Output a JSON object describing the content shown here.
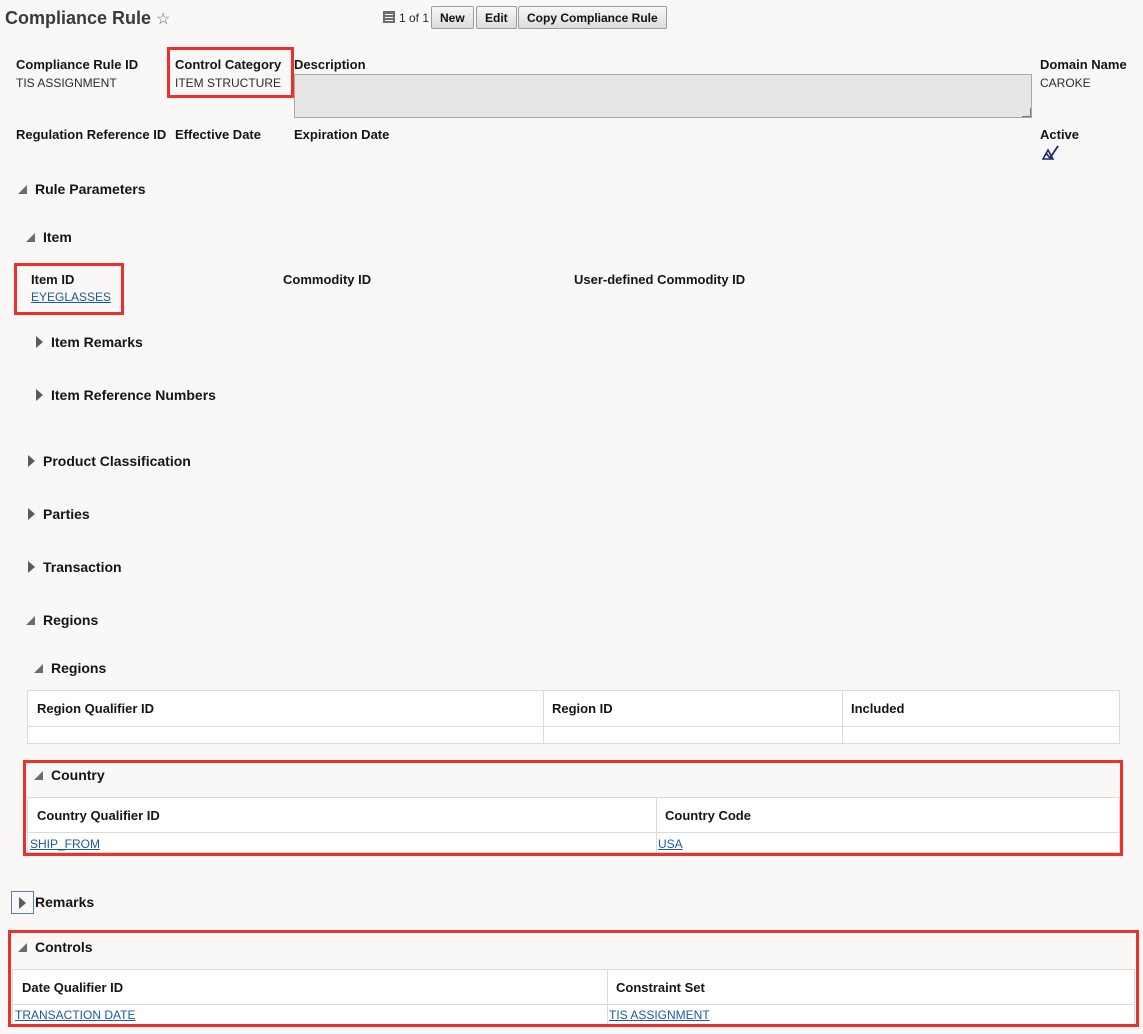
{
  "header": {
    "title": "Compliance Rule",
    "favorite_icon": "star-icon",
    "record_counter": "1 of 1",
    "new_label": "New",
    "edit_label": "Edit",
    "copy_label": "Copy Compliance Rule"
  },
  "fields": {
    "rule_id_label": "Compliance Rule ID",
    "rule_id_value": "TIS ASSIGNMENT",
    "control_category_label": "Control Category",
    "control_category_value": "ITEM STRUCTURE",
    "description_label": "Description",
    "description_value": "",
    "domain_label": "Domain Name",
    "domain_value": "CAROKE",
    "regulation_ref_label": "Regulation Reference ID",
    "effective_date_label": "Effective Date",
    "expiration_date_label": "Expiration Date",
    "active_label": "Active",
    "active_icon": "checkbox-checked-icon"
  },
  "rule_parameters": {
    "label": "Rule Parameters",
    "item": {
      "label": "Item",
      "item_id_label": "Item ID",
      "item_id_value": "EYEGLASSES",
      "commodity_id_label": "Commodity ID",
      "user_commodity_id_label": "User-defined Commodity ID",
      "item_remarks_label": "Item Remarks",
      "item_ref_numbers_label": "Item Reference Numbers"
    },
    "product_classification_label": "Product Classification",
    "parties_label": "Parties",
    "transaction_label": "Transaction",
    "regions": {
      "label": "Regions",
      "sub_label": "Regions",
      "columns": [
        "Region Qualifier ID",
        "Region ID",
        "Included"
      ]
    },
    "country": {
      "label": "Country",
      "columns": [
        "Country Qualifier ID",
        "Country Code"
      ],
      "rows": [
        [
          "SHIP_FROM",
          "USA"
        ]
      ]
    }
  },
  "remarks_label": "Remarks",
  "controls": {
    "label": "Controls",
    "columns": [
      "Date Qualifier ID",
      "Constraint Set"
    ],
    "rows": [
      [
        "TRANSACTION DATE",
        "TIS ASSIGNMENT"
      ]
    ]
  },
  "colors": {
    "highlight": "#e8322b",
    "link": "#1d5aa0",
    "background": "#f9f8f6"
  }
}
